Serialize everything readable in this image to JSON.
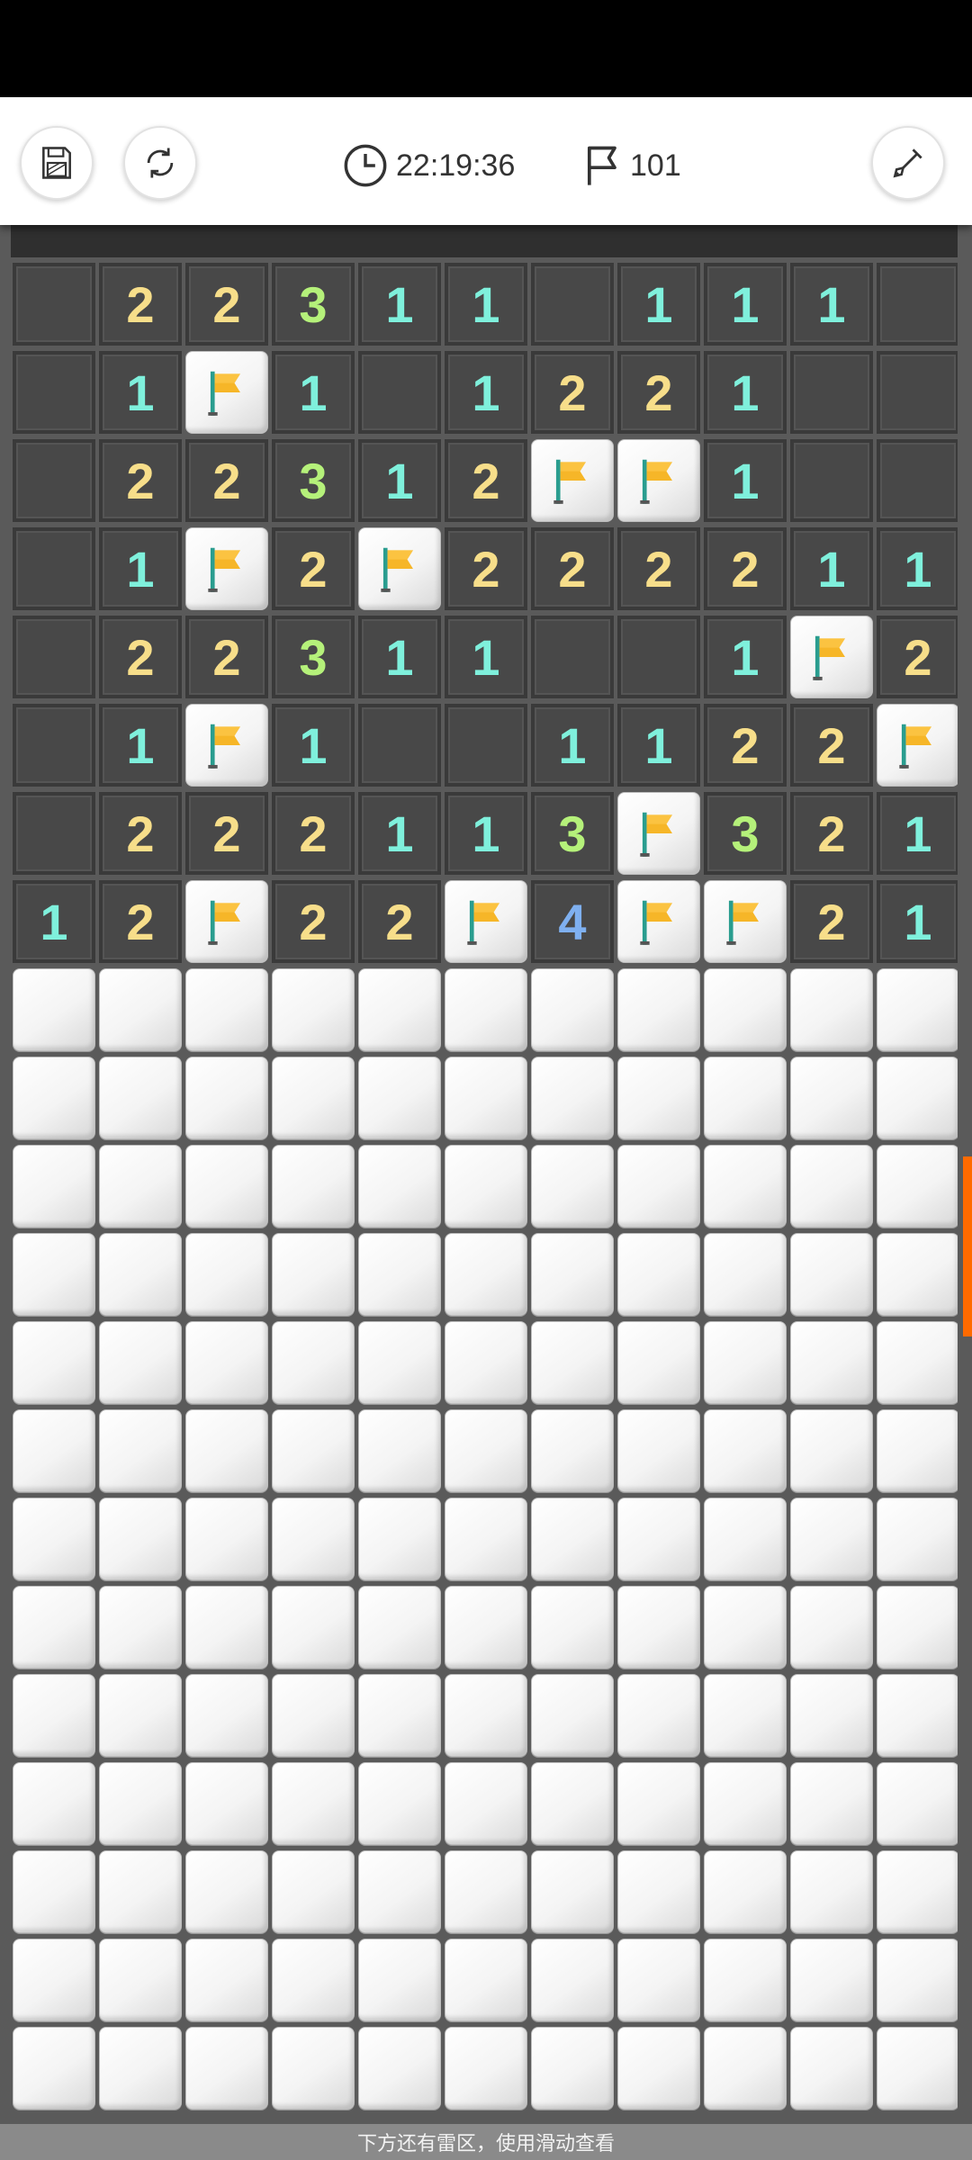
{
  "toolbar": {
    "timer": "22:19:36",
    "flags_remaining": "101",
    "icons": {
      "save": "save-icon",
      "restart": "refresh-icon",
      "timer": "clock-icon",
      "flags": "flag-outline-icon",
      "tool": "shovel-icon"
    }
  },
  "board": {
    "columns": 11,
    "visible_rows": [
      [
        "_",
        "2",
        "2",
        "3",
        "1",
        "1",
        "_",
        "1",
        "1",
        "1",
        "_"
      ],
      [
        "_",
        "1",
        "F",
        "1",
        "_",
        "1",
        "2",
        "2",
        "1",
        "_",
        "_"
      ],
      [
        "_",
        "2",
        "2",
        "3",
        "1",
        "2",
        "F",
        "F",
        "1",
        "_",
        "_"
      ],
      [
        "_",
        "1",
        "F",
        "2",
        "F",
        "2",
        "2",
        "2",
        "2",
        "1",
        "1"
      ],
      [
        "_",
        "2",
        "2",
        "3",
        "1",
        "1",
        "_",
        "_",
        "1",
        "F",
        "2"
      ],
      [
        "_",
        "1",
        "F",
        "1",
        "_",
        "_",
        "1",
        "1",
        "2",
        "2",
        "F"
      ],
      [
        "_",
        "2",
        "2",
        "2",
        "1",
        "1",
        "3",
        "F",
        "3",
        "2",
        "1"
      ],
      [
        "1",
        "2",
        "F",
        "2",
        "2",
        "F",
        "4",
        "F",
        "F",
        "2",
        "1"
      ]
    ],
    "hidden_rows": 13,
    "number_colors": {
      "1": "#7ff0dc",
      "2": "#f7de8a",
      "3": "#b5f17a",
      "4": "#7fb0f0"
    },
    "flag_color": "#f6b628"
  },
  "hint": {
    "text": "下方还有雷区，使用滑动查看"
  }
}
